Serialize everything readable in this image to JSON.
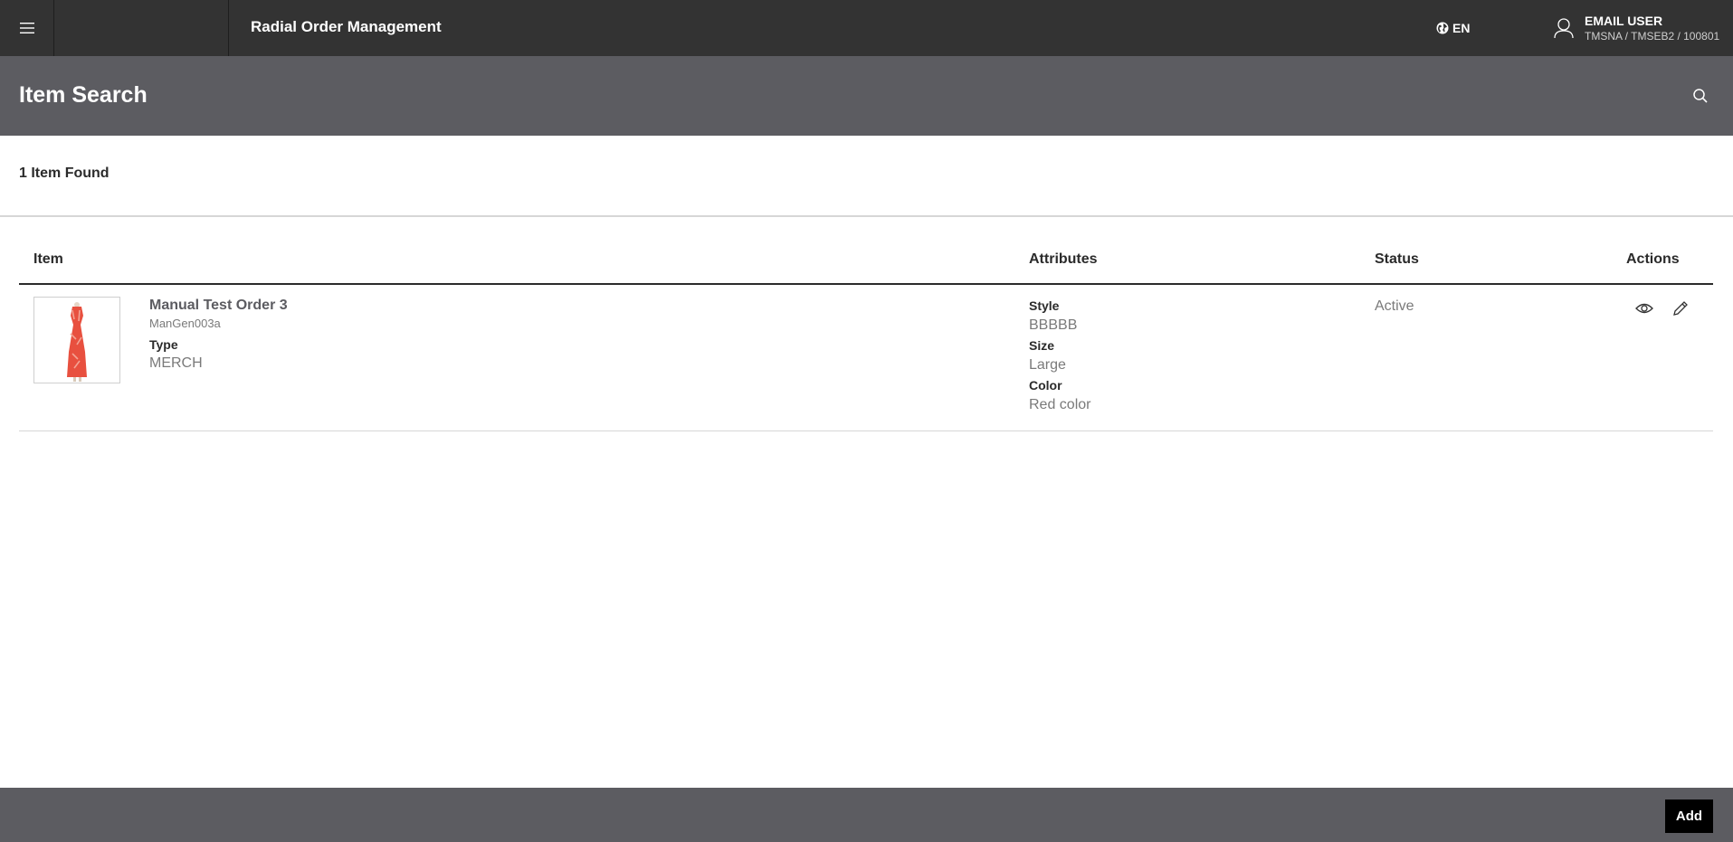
{
  "app": {
    "title": "Radial Order Management",
    "language": "EN"
  },
  "user": {
    "name": "EMAIL USER",
    "org": "TMSNA / TMSEB2 / 100801"
  },
  "page": {
    "title": "Item Search",
    "result_count": "1 Item Found"
  },
  "table": {
    "headers": {
      "item": "Item",
      "attributes": "Attributes",
      "status": "Status",
      "actions": "Actions"
    },
    "rows": [
      {
        "name": "Manual Test Order 3",
        "id": "ManGen003a",
        "type_label": "Type",
        "type_value": "MERCH",
        "attributes": [
          {
            "label": "Style",
            "value": "BBBBB"
          },
          {
            "label": "Size",
            "value": "Large"
          },
          {
            "label": "Color",
            "value": "Red color"
          }
        ],
        "status": "Active",
        "actions": [
          "eye-icon",
          "pencil-icon"
        ]
      }
    ]
  },
  "footer": {
    "add_label": "Add"
  },
  "colors": {
    "topbar": "#333333",
    "header": "#5c5c61",
    "footer": "#5c5c61",
    "button": "#000000"
  }
}
